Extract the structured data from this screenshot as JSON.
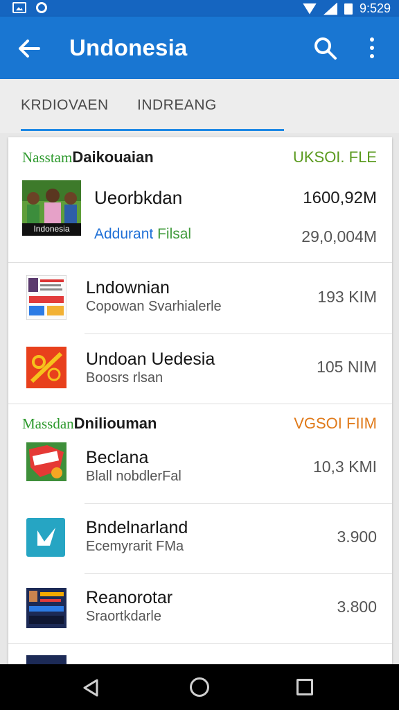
{
  "status_bar": {
    "time": "9:529",
    "icons": [
      "gallery-icon",
      "sync-icon",
      "wifi-icon",
      "signal-icon",
      "battery-icon"
    ]
  },
  "app_bar": {
    "title": "Undonesia",
    "color": "#1976d2",
    "icons": [
      "back-arrow-icon",
      "search-icon",
      "more-vert-icon"
    ]
  },
  "tabs": [
    {
      "label": "KRDIOVAEN",
      "selected": true
    },
    {
      "label": "INDREANG",
      "selected": false
    }
  ],
  "sections": [
    {
      "heading_green": "Nasstam",
      "heading_dark": "Daikouaian",
      "right_label": "UKSOI. FLE",
      "right_color": "#5a9a1e",
      "featured": {
        "title": "Ueorbkdan",
        "subtitle": "Addurant",
        "subtitle_accent": "Filsal",
        "size_primary": "1600,92M",
        "size_secondary": "29,0,004M",
        "thumb_caption": "Indonesia"
      },
      "items": [
        {
          "title": "Lndownian",
          "subtitle": "Copowan Svarhialerle",
          "size": "193 KIM",
          "icon": "document-thumbnail-icon"
        },
        {
          "title": "Undoan Uedesia",
          "subtitle": "Boosrs rlsan",
          "size": "105 NIM",
          "icon": "red-app-icon"
        }
      ]
    },
    {
      "heading_green": "Massdan",
      "heading_dark": "Dniliouman",
      "right_label": "VGSOI FIIM",
      "right_color": "#e07a1a",
      "items": [
        {
          "title": "Beclana",
          "subtitle": "Blall nobdlerFal",
          "size": "10,3 KMI",
          "icon": "sticker-app-icon"
        },
        {
          "title": "Bndelnarland",
          "subtitle": "Ecemyrarit FMa",
          "size": "3.900",
          "icon": "teal-app-icon"
        },
        {
          "title": "Reanorotar",
          "subtitle": "Sraortkdarle",
          "size": "3.800",
          "icon": "poster-app-icon"
        }
      ]
    }
  ]
}
